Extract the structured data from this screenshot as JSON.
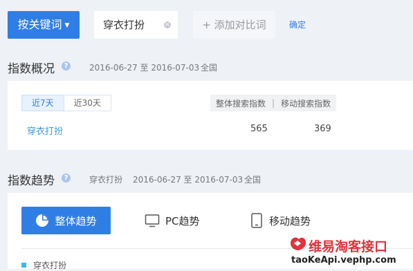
{
  "toolbar": {
    "keyword_button": "按关键词",
    "keyword_value": "穿衣打扮",
    "add_compare": "+ 添加对比词",
    "confirm": "确定"
  },
  "overview": {
    "title": "指数概况",
    "date_range": "2016-06-27 至 2016-07-03",
    "region": "全国",
    "tabs": [
      "近7天",
      "近30天"
    ],
    "headers": [
      "整体搜索指数",
      "移动搜索指数"
    ],
    "header_sep": "|",
    "row": {
      "keyword": "穿衣打扮",
      "overall": "565",
      "mobile": "369"
    }
  },
  "trend": {
    "title": "指数趋势",
    "keyword": "穿衣打扮",
    "date_range": "2016-06-27 至 2016-07-03",
    "region": "全国",
    "options": [
      "整体趋势",
      "PC趋势",
      "移动趋势"
    ],
    "legend": "穿衣打扮",
    "legend_color": "#35b8e8"
  },
  "watermark": {
    "title": "维易淘客接口",
    "url": "taoKeApi.vephp.com"
  }
}
